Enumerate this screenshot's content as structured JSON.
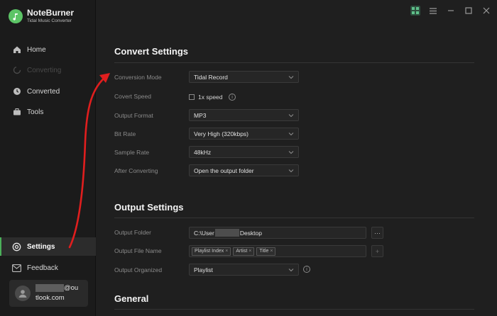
{
  "app": {
    "name": "NoteBurner",
    "subtitle": "Tidal Music Converter"
  },
  "sidebar": {
    "items": [
      {
        "label": "Home",
        "icon": "home-icon"
      },
      {
        "label": "Converting",
        "icon": "converting-icon",
        "disabled": true
      },
      {
        "label": "Converted",
        "icon": "clock-icon"
      },
      {
        "label": "Tools",
        "icon": "toolbox-icon"
      },
      {
        "label": "Settings",
        "icon": "gear-icon",
        "active": true
      },
      {
        "label": "Feedback",
        "icon": "mail-icon"
      }
    ],
    "account": {
      "email_suffix_line1": "@ou",
      "email_line2": "tlook.com"
    }
  },
  "window_controls": [
    "grid-icon",
    "menu-icon",
    "minimize-icon",
    "maximize-icon",
    "close-icon"
  ],
  "convert_settings": {
    "title": "Convert Settings",
    "conversion_mode": {
      "label": "Conversion Mode",
      "value": "Tidal Record"
    },
    "convert_speed": {
      "label": "Covert Speed",
      "option": "1x speed",
      "checked": false
    },
    "output_format": {
      "label": "Output Format",
      "value": "MP3"
    },
    "bit_rate": {
      "label": "Bit Rate",
      "value": "Very High (320kbps)"
    },
    "sample_rate": {
      "label": "Sample Rate",
      "value": "48kHz"
    },
    "after_converting": {
      "label": "After Converting",
      "value": "Open the output folder"
    }
  },
  "output_settings": {
    "title": "Output Settings",
    "output_folder": {
      "label": "Output Folder",
      "value_prefix": "C:\\User",
      "value_suffix": "Desktop",
      "browse_label": "···"
    },
    "output_file_name": {
      "label": "Output File Name",
      "tags": [
        "Playlist Index",
        "Artist",
        "Title"
      ],
      "add_label": "+"
    },
    "output_organized": {
      "label": "Output Organized",
      "value": "Playlist"
    }
  },
  "general": {
    "title": "General"
  },
  "colors": {
    "accent": "#4bb05a",
    "annotation": "#e01e1e"
  }
}
